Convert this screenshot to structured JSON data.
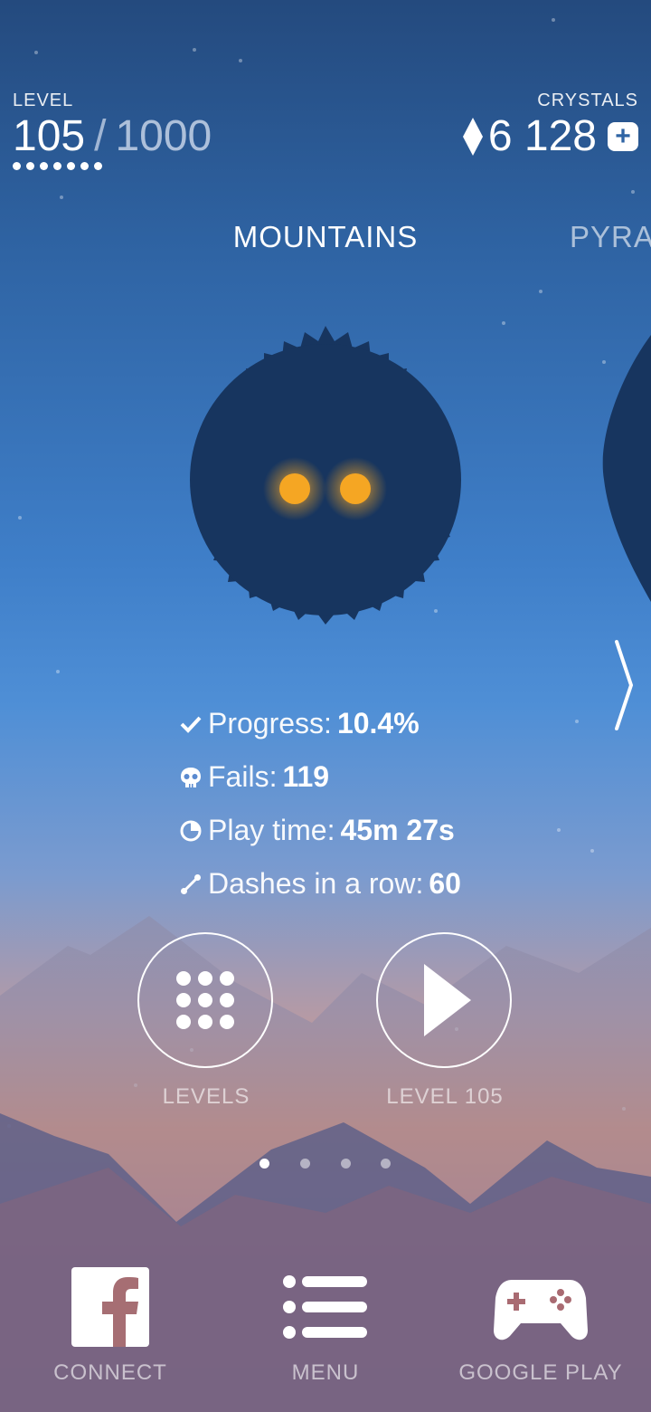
{
  "hud": {
    "level_label": "LEVEL",
    "level_current": "105",
    "level_separator": "/",
    "level_max": "1000",
    "crystals_label": "CRYSTALS",
    "crystals_value": "6 128",
    "add_crystals_label": "+"
  },
  "world": {
    "current": "MOUNTAINS",
    "next": "PYRA"
  },
  "stats": [
    {
      "icon": "check-icon",
      "label": "Progress:",
      "value": "10.4%"
    },
    {
      "icon": "skull-icon",
      "label": "Fails:",
      "value": "119"
    },
    {
      "icon": "clock-icon",
      "label": "Play time:",
      "value": "45m 27s"
    },
    {
      "icon": "dash-icon",
      "label": "Dashes in a row:",
      "value": "60"
    }
  ],
  "actions": {
    "levels_label": "LEVELS",
    "play_label": "LEVEL 105"
  },
  "pager": {
    "count": 4,
    "active_index": 0
  },
  "bottom_bar": {
    "connect_label": "CONNECT",
    "menu_label": "MENU",
    "google_play_label": "GOOGLE PLAY"
  },
  "colors": {
    "creature": "#17355f",
    "eyes": "#f5a623",
    "sky_top": "#244a7e",
    "sky_bottom": "#a86a73"
  }
}
